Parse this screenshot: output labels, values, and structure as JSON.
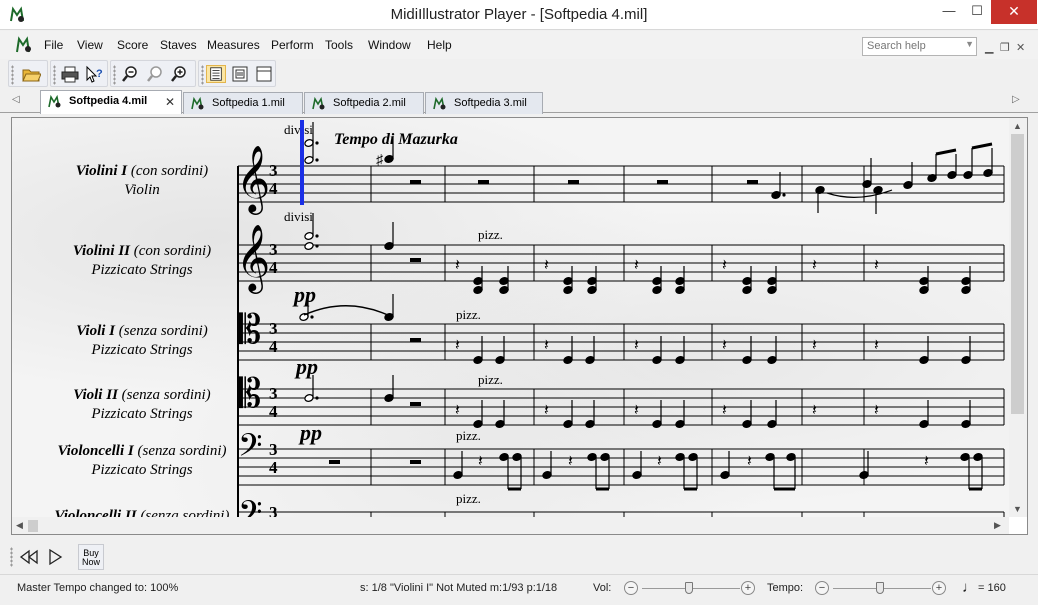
{
  "window": {
    "title": "MidiIllustrator Player - [Softpedia 4.mil]",
    "minimize": "—",
    "maximize": "☐",
    "close": "✕"
  },
  "menu": {
    "items": [
      "File",
      "View",
      "Score",
      "Staves",
      "Measures",
      "Perform",
      "Tools",
      "Window",
      "Help"
    ],
    "search_placeholder": "Search help"
  },
  "tabs": [
    {
      "label": "Softpedia 4.mil",
      "active": true
    },
    {
      "label": "Softpedia 1.mil",
      "active": false
    },
    {
      "label": "Softpedia 2.mil",
      "active": false
    },
    {
      "label": "Softpedia 3.mil",
      "active": false
    }
  ],
  "score": {
    "tempo_marking": "Tempo di Mazurka",
    "text_marks": {
      "divisi": "divisi",
      "pizz": "pizz.",
      "pp": "pp"
    },
    "parts": [
      {
        "name": "Violini I",
        "qualifier": "(con sordini)",
        "instrument": "Violin"
      },
      {
        "name": "Violini II",
        "qualifier": "(con sordini)",
        "instrument": "Pizzicato Strings"
      },
      {
        "name": "Violi I",
        "qualifier": "(senza sordini)",
        "instrument": "Pizzicato Strings"
      },
      {
        "name": "Violi II",
        "qualifier": "(senza sordini)",
        "instrument": "Pizzicato Strings"
      },
      {
        "name": "Violoncelli I",
        "qualifier": "(senza sordini)",
        "instrument": "Pizzicato Strings"
      },
      {
        "name": "Violoncelli II",
        "qualifier": "(senza sordini)",
        "instrument": ""
      }
    ],
    "time_signature": {
      "top": "3",
      "bottom": "4"
    }
  },
  "playbar": {
    "buy_now": "Buy Now"
  },
  "status": {
    "message": "Master Tempo changed to: 100%",
    "info": "s: 1/8 \"Violini I\" Not Muted  m:1/93  p:1/18",
    "vol_label": "Vol:",
    "tempo_label": "Tempo:",
    "tempo_value": "= 160",
    "minus": "−",
    "plus": "+"
  },
  "colors": {
    "playhead": "#1a2fe6",
    "close_button": "#c7312a",
    "active_tool": "#fbe6a3"
  }
}
